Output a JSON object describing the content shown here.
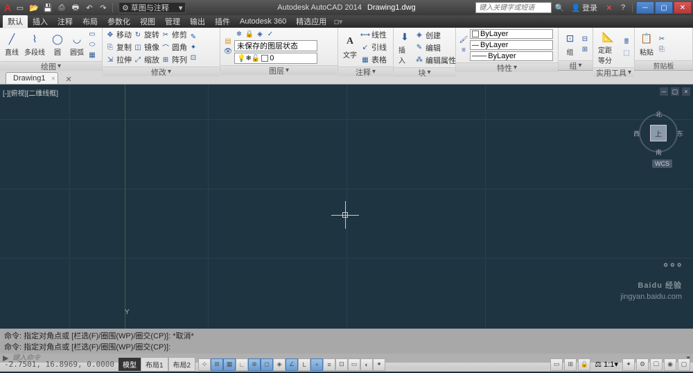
{
  "title": {
    "app": "Autodesk AutoCAD 2014",
    "file": "Drawing1.dwg"
  },
  "workspace": "草图与注释",
  "search_placeholder": "键入关键字或短语",
  "login": "登录",
  "menus": [
    "默认",
    "插入",
    "注释",
    "布局",
    "参数化",
    "视图",
    "管理",
    "输出",
    "插件",
    "Autodesk 360",
    "精选应用"
  ],
  "draw": {
    "panel": "绘图",
    "line": "直线",
    "pline": "多段线",
    "circle": "圆",
    "arc": "圆弧"
  },
  "modify": {
    "panel": "修改",
    "move": "移动",
    "rotate": "旋转",
    "trim": "修剪",
    "copy": "复制",
    "mirror": "镜像",
    "fillet": "圆角",
    "stretch": "拉伸",
    "scale": "缩放",
    "array": "阵列"
  },
  "layers": {
    "panel": "图层",
    "state": "未保存的图层状态",
    "current": "0"
  },
  "annot": {
    "panel": "注释",
    "text": "文字",
    "dim_lin": "线性",
    "leader": "引线",
    "table": "表格"
  },
  "block": {
    "panel": "块",
    "insert": "插入",
    "create": "创建",
    "edit": "编辑",
    "attr": "编辑属性"
  },
  "props": {
    "panel": "特性",
    "layer": "ByLayer",
    "ltype": "ByLayer",
    "lweight": "ByLayer"
  },
  "group": {
    "panel": "组",
    "btn": "组"
  },
  "utils": {
    "panel": "实用工具",
    "measure": "定距等分"
  },
  "clip": {
    "panel": "剪贴板",
    "paste": "粘贴"
  },
  "file_tab": "Drawing1",
  "viewport_label": "[-][俯视][二维线框]",
  "viewcube": {
    "top": "上",
    "n": "北",
    "s": "南",
    "e": "东",
    "w": "西",
    "wcs": "WCS"
  },
  "ucs": {
    "y": "Y"
  },
  "cmd": {
    "hist1": "命令: 指定对角点或 [栏选(F)/圈围(WP)/圈交(CP)]: *取消*",
    "hist2": "命令: 指定对角点或 [栏选(F)/圈围(WP)/圈交(CP)]:",
    "placeholder": "键入命令"
  },
  "status": {
    "coords": "-2.7501, 16.8969, 0.0000",
    "model": "模型",
    "layout1": "布局1",
    "layout2": "布局2",
    "scale": "1:1"
  },
  "watermark": {
    "logo": "Baidu 经验",
    "url": "jingyan.baidu.com"
  }
}
